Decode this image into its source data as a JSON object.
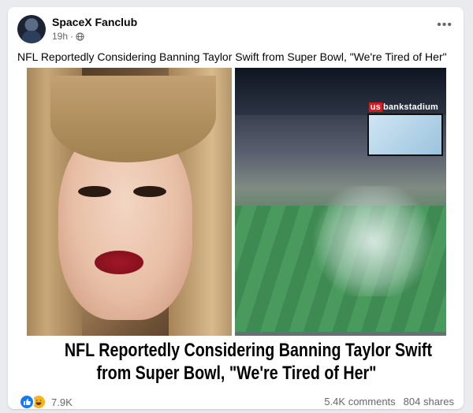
{
  "post": {
    "page_name": "SpaceX Fanclub",
    "time": "19h",
    "time_separator": "·",
    "caption": "NFL Reportedly Considering Banning Taylor Swift from Super Bowl, \"We're Tired of Her\"",
    "image": {
      "stadium_sign_us": "us",
      "stadium_sign_rest": "bankstadium",
      "headline_line1": "NFL Reportedly Considering Banning Taylor Swift",
      "headline_line2": "from Super Bowl, \"We're Tired of Her\""
    },
    "reactions": {
      "icons": [
        "like-icon",
        "haha-icon"
      ],
      "count": "7.9K"
    },
    "comments": "5.4K comments",
    "shares": "804 shares",
    "more_label": "•••"
  },
  "colors": {
    "like_blue": "#1877f2",
    "haha_yellow": "#f7b125",
    "secondary_text": "#65676b"
  }
}
